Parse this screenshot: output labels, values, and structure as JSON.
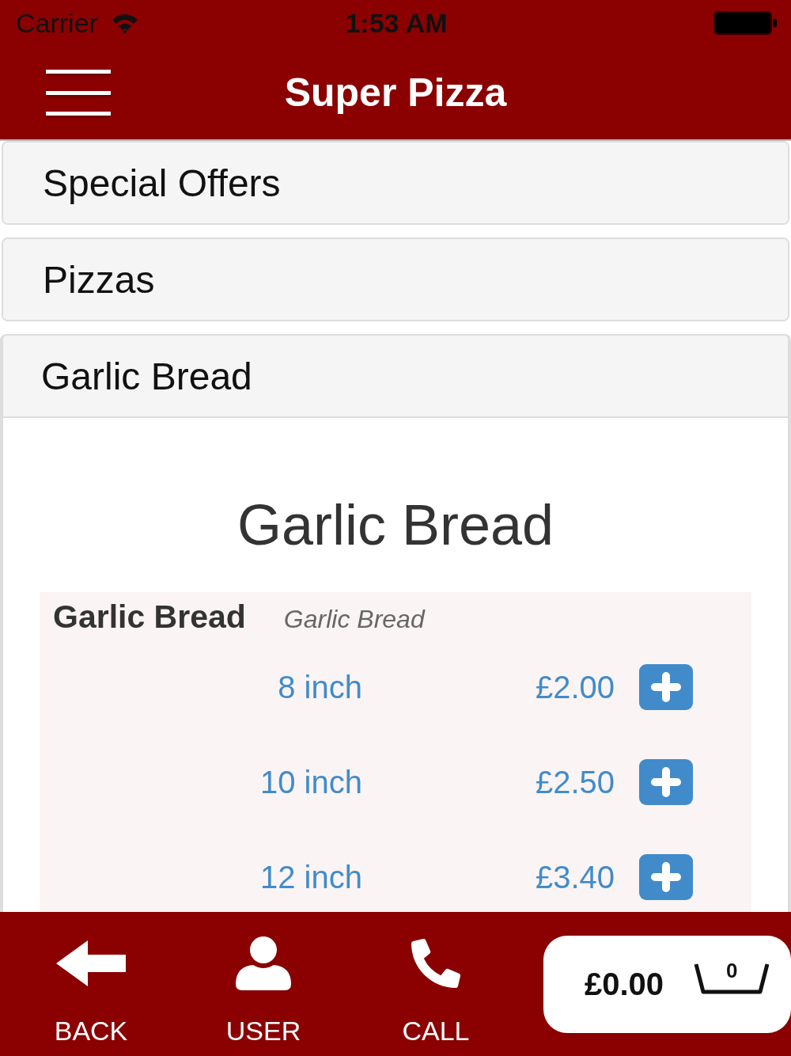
{
  "status_bar": {
    "carrier": "Carrier",
    "time": "1:53 AM"
  },
  "nav_bar": {
    "title": "Super Pizza"
  },
  "categories": [
    {
      "label": "Special Offers",
      "expanded": false
    },
    {
      "label": "Pizzas",
      "expanded": false
    },
    {
      "label": "Garlic Bread",
      "expanded": true,
      "heading": "Garlic Bread",
      "products": [
        {
          "name": "Garlic Bread",
          "description": "Garlic Bread",
          "options": [
            {
              "size": "8 inch",
              "price": "£2.00"
            },
            {
              "size": "10 inch",
              "price": "£2.50"
            },
            {
              "size": "12 inch",
              "price": "£3.40"
            }
          ]
        }
      ]
    }
  ],
  "bottom_bar": {
    "buttons": [
      {
        "label": "BACK",
        "kind": "back"
      },
      {
        "label": "USER",
        "kind": "user"
      },
      {
        "label": "CALL",
        "kind": "call"
      }
    ],
    "cart": {
      "total": "£0.00",
      "count": "0"
    }
  }
}
